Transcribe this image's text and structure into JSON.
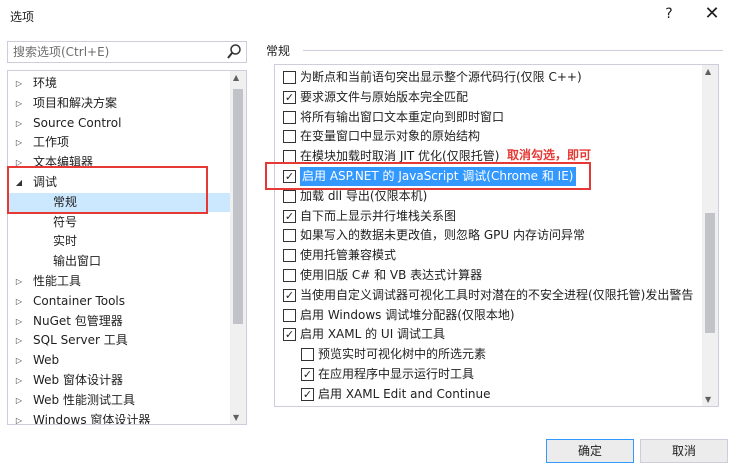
{
  "window": {
    "title": "选项",
    "help": "?",
    "close": "✕"
  },
  "search": {
    "placeholder": "搜索选项(Ctrl+E)"
  },
  "tree": {
    "items": [
      {
        "label": "环境",
        "arrow": "▷",
        "depth": 0,
        "selected": false
      },
      {
        "label": "项目和解决方案",
        "arrow": "▷",
        "depth": 0,
        "selected": false
      },
      {
        "label": "Source Control",
        "arrow": "▷",
        "depth": 0,
        "selected": false
      },
      {
        "label": "工作项",
        "arrow": "▷",
        "depth": 0,
        "selected": false
      },
      {
        "label": "文本编辑器",
        "arrow": "▷",
        "depth": 0,
        "selected": false
      },
      {
        "label": "调试",
        "arrow": "◢",
        "depth": 0,
        "selected": false
      },
      {
        "label": "常规",
        "arrow": "",
        "depth": 1,
        "selected": true
      },
      {
        "label": "符号",
        "arrow": "",
        "depth": 1,
        "selected": false
      },
      {
        "label": "实时",
        "arrow": "",
        "depth": 1,
        "selected": false
      },
      {
        "label": "输出窗口",
        "arrow": "",
        "depth": 1,
        "selected": false
      },
      {
        "label": "性能工具",
        "arrow": "▷",
        "depth": 0,
        "selected": false
      },
      {
        "label": "Container Tools",
        "arrow": "▷",
        "depth": 0,
        "selected": false
      },
      {
        "label": "NuGet 包管理器",
        "arrow": "▷",
        "depth": 0,
        "selected": false
      },
      {
        "label": "SQL Server 工具",
        "arrow": "▷",
        "depth": 0,
        "selected": false
      },
      {
        "label": "Web",
        "arrow": "▷",
        "depth": 0,
        "selected": false
      },
      {
        "label": "Web 窗体设计器",
        "arrow": "▷",
        "depth": 0,
        "selected": false
      },
      {
        "label": "Web 性能测试工具",
        "arrow": "▷",
        "depth": 0,
        "selected": false
      },
      {
        "label": "Windows 窗体设计器",
        "arrow": "▷",
        "depth": 0,
        "selected": false
      }
    ]
  },
  "section": {
    "title": "常规"
  },
  "options": [
    {
      "label": "为断点和当前语句突出显示整个源代码行(仅限 C++)",
      "checked": false,
      "indent": 0
    },
    {
      "label": "要求源文件与原始版本完全匹配",
      "checked": true,
      "indent": 0
    },
    {
      "label": "将所有输出窗口文本重定向到即时窗口",
      "checked": false,
      "indent": 0
    },
    {
      "label": "在变量窗口中显示对象的原始结构",
      "checked": false,
      "indent": 0
    },
    {
      "label": "在模块加载时取消 JIT 优化(仅限托管)",
      "checked": false,
      "indent": 0
    },
    {
      "label": "启用 ASP.NET 的 JavaScript 调试(Chrome 和 IE)",
      "checked": true,
      "indent": 0,
      "highlight": true
    },
    {
      "label": "加载 dll 导出(仅限本机)",
      "checked": false,
      "indent": 0
    },
    {
      "label": "自下而上显示并行堆栈关系图",
      "checked": true,
      "indent": 0
    },
    {
      "label": "如果写入的数据未更改值，则忽略 GPU 内存访问异常",
      "checked": false,
      "indent": 0
    },
    {
      "label": "使用托管兼容模式",
      "checked": false,
      "indent": 0
    },
    {
      "label": "使用旧版 C# 和 VB 表达式计算器",
      "checked": false,
      "indent": 0
    },
    {
      "label": "当使用自定义调试器可视化工具时对潜在的不安全进程(仅限托管)发出警告",
      "checked": true,
      "indent": 0
    },
    {
      "label": "启用 Windows 调试堆分配器(仅限本地)",
      "checked": false,
      "indent": 0
    },
    {
      "label": "启用 XAML 的 UI 调试工具",
      "checked": true,
      "indent": 0
    },
    {
      "label": "预览实时可视化树中的所选元素",
      "checked": false,
      "indent": 1
    },
    {
      "label": "在应用程序中显示运行时工具",
      "checked": true,
      "indent": 1
    },
    {
      "label": "启用 XAML Edit and Continue",
      "checked": true,
      "indent": 1
    }
  ],
  "annotation": {
    "text": "取消勾选，即可",
    "color": "#e53935"
  },
  "buttons": {
    "ok": "确定",
    "cancel": "取消"
  },
  "colors": {
    "selection": "#cce8ff",
    "highlight": "#3399ff",
    "annotation": "#e53935"
  }
}
